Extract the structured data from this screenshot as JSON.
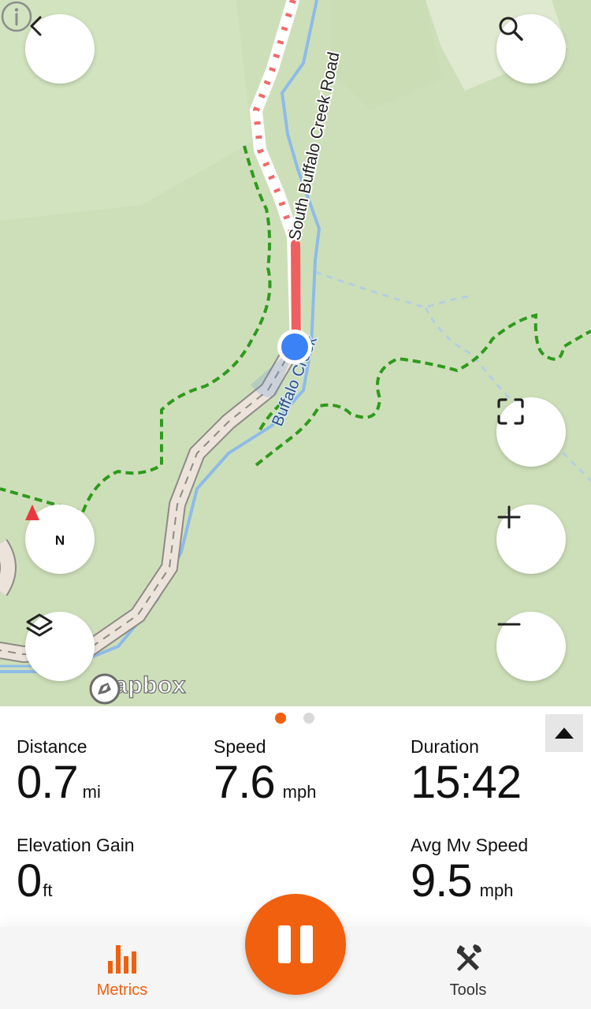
{
  "colors": {
    "accent": "#f0600f",
    "map_background": "#cddfb9",
    "trail_green": "#2f9a1e",
    "water_blue": "#8ebbe8",
    "location_blue": "#3b82f6",
    "active_tab": "#f0600f",
    "inactive_tab": "#333333"
  },
  "map": {
    "road_label": "South Buffalo Creek Road",
    "creek_label": "Buffalo Creek",
    "attribution": "mapbox",
    "compass_letter": "N",
    "buttons": [
      "back-icon",
      "search-icon",
      "fullscreen-icon",
      "zoom-in-icon",
      "zoom-out-icon",
      "compass-icon",
      "layers-icon",
      "info-icon"
    ]
  },
  "pager": {
    "pages": 2,
    "active_index": 0
  },
  "metrics": {
    "distance": {
      "label": "Distance",
      "value": "0.7",
      "unit": "mi"
    },
    "speed": {
      "label": "Speed",
      "value": "7.6",
      "unit": "mph"
    },
    "duration": {
      "label": "Duration",
      "value": "15:42",
      "unit": ""
    },
    "elevation_gain": {
      "label": "Elevation Gain",
      "value": "0",
      "unit": "ft"
    },
    "avg_mv_speed": {
      "label": "Avg Mv Speed",
      "value": "9.5",
      "unit": "mph"
    }
  },
  "tabs": {
    "metrics": {
      "label": "Metrics",
      "icon": "bar-chart-icon",
      "active": true
    },
    "tools": {
      "label": "Tools",
      "icon": "tools-icon",
      "active": false
    }
  },
  "controls": {
    "pause_icon": "pause-icon",
    "collapse_icon": "caret-up-icon"
  }
}
